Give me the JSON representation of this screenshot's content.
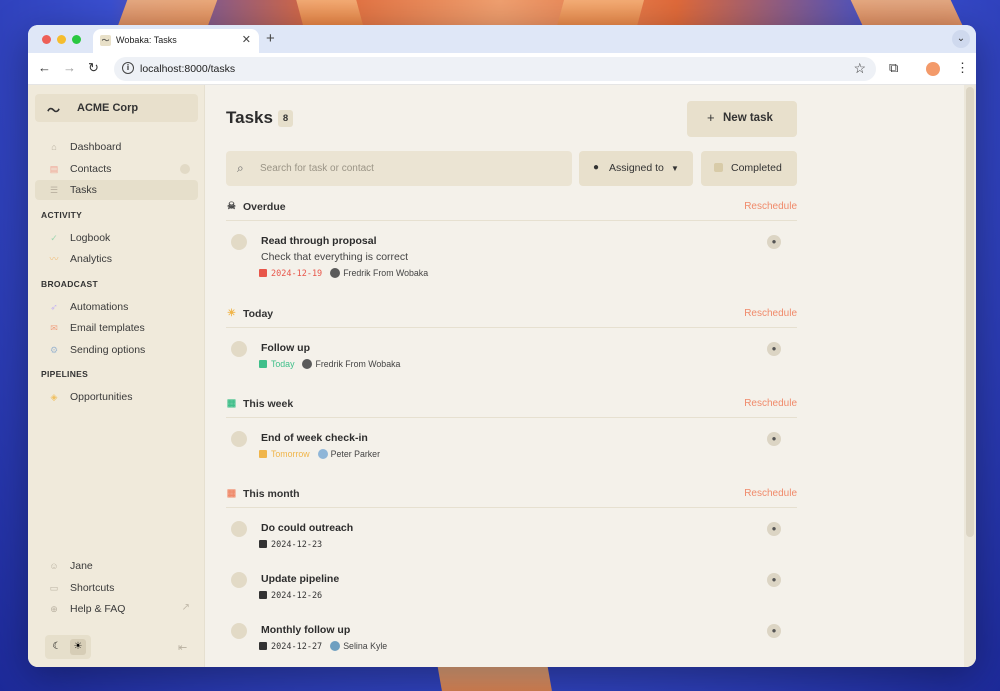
{
  "browser": {
    "tab_title": "Wobaka: Tasks",
    "url": "localhost:8000/tasks"
  },
  "sidebar": {
    "org_name": "ACME Corp",
    "main_items": [
      {
        "label": "Dashboard",
        "icon": "home-icon"
      },
      {
        "label": "Contacts",
        "icon": "contacts-icon"
      },
      {
        "label": "Tasks",
        "icon": "tasks-icon",
        "active": true
      }
    ],
    "sections": [
      {
        "title": "ACTIVITY",
        "items": [
          {
            "label": "Logbook",
            "icon": "check-icon"
          },
          {
            "label": "Analytics",
            "icon": "chart-icon"
          }
        ]
      },
      {
        "title": "BROADCAST",
        "items": [
          {
            "label": "Automations",
            "icon": "rocket-icon"
          },
          {
            "label": "Email templates",
            "icon": "mail-icon"
          },
          {
            "label": "Sending options",
            "icon": "settings-icon"
          }
        ]
      },
      {
        "title": "PIPELINES",
        "items": [
          {
            "label": "Opportunities",
            "icon": "stack-icon"
          }
        ]
      }
    ],
    "bottom_items": [
      {
        "label": "Jane",
        "icon": "user-icon"
      },
      {
        "label": "Shortcuts",
        "icon": "keyboard-icon"
      },
      {
        "label": "Help & FAQ",
        "icon": "help-icon"
      }
    ]
  },
  "main": {
    "title": "Tasks",
    "count": "8",
    "new_task_label": "New task",
    "search_placeholder": "Search for task or contact",
    "assigned_filter": "Assigned to",
    "completed_filter": "Completed",
    "reschedule_label": "Reschedule",
    "colors": {
      "overdue": "#e8564a",
      "today": "#3fbf8a",
      "tomorrow": "#f0b54a",
      "accent": "#f08a6a"
    },
    "groups": [
      {
        "name": "Overdue",
        "icon": "skull-icon",
        "tasks": [
          {
            "title": "Read through proposal",
            "description": "Check that everything is correct",
            "date": "2024-12-19",
            "date_style": "overdue",
            "person": "Fredrik From Wobaka"
          }
        ]
      },
      {
        "name": "Today",
        "icon": "sun-icon",
        "tasks": [
          {
            "title": "Follow up",
            "description": "",
            "date": "Today",
            "date_style": "today",
            "person": "Fredrik From Wobaka"
          }
        ]
      },
      {
        "name": "This week",
        "icon": "calendar-week-icon",
        "tasks": [
          {
            "title": "End of week check-in",
            "description": "",
            "date": "Tomorrow",
            "date_style": "tomorrow",
            "person": "Peter Parker"
          }
        ]
      },
      {
        "name": "This month",
        "icon": "calendar-month-icon",
        "tasks": [
          {
            "title": "Do could outreach",
            "description": "",
            "date": "2024-12-23",
            "date_style": "normal",
            "person": ""
          },
          {
            "title": "Update pipeline",
            "description": "",
            "date": "2024-12-26",
            "date_style": "normal",
            "person": ""
          },
          {
            "title": "Monthly follow up",
            "description": "",
            "date": "2024-12-27",
            "date_style": "normal",
            "person": "Selina Kyle"
          }
        ]
      }
    ]
  }
}
